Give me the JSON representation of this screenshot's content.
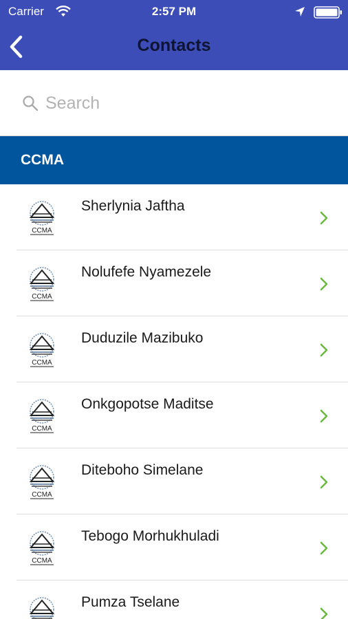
{
  "status_bar": {
    "carrier": "Carrier",
    "time": "2:57 PM"
  },
  "nav": {
    "title": "Contacts",
    "back_icon": "chevron-left-icon"
  },
  "search": {
    "placeholder": "Search",
    "value": ""
  },
  "section": {
    "label": "CCMA"
  },
  "contacts": [
    {
      "name": "Sherlynia Jaftha",
      "logo_text": "CCMA"
    },
    {
      "name": "Nolufefe Nyamezele",
      "logo_text": "CCMA"
    },
    {
      "name": "Duduzile Mazibuko",
      "logo_text": "CCMA"
    },
    {
      "name": "Onkgopotse Maditse",
      "logo_text": "CCMA"
    },
    {
      "name": "Diteboho Simelane",
      "logo_text": "CCMA"
    },
    {
      "name": "Tebogo Morhukhuladi",
      "logo_text": "CCMA"
    },
    {
      "name": "Pumza Tselane",
      "logo_text": "CCMA"
    }
  ],
  "colors": {
    "nav_bg": "#3d4db7",
    "section_bg": "#00559c",
    "chevron": "#6bb842"
  }
}
